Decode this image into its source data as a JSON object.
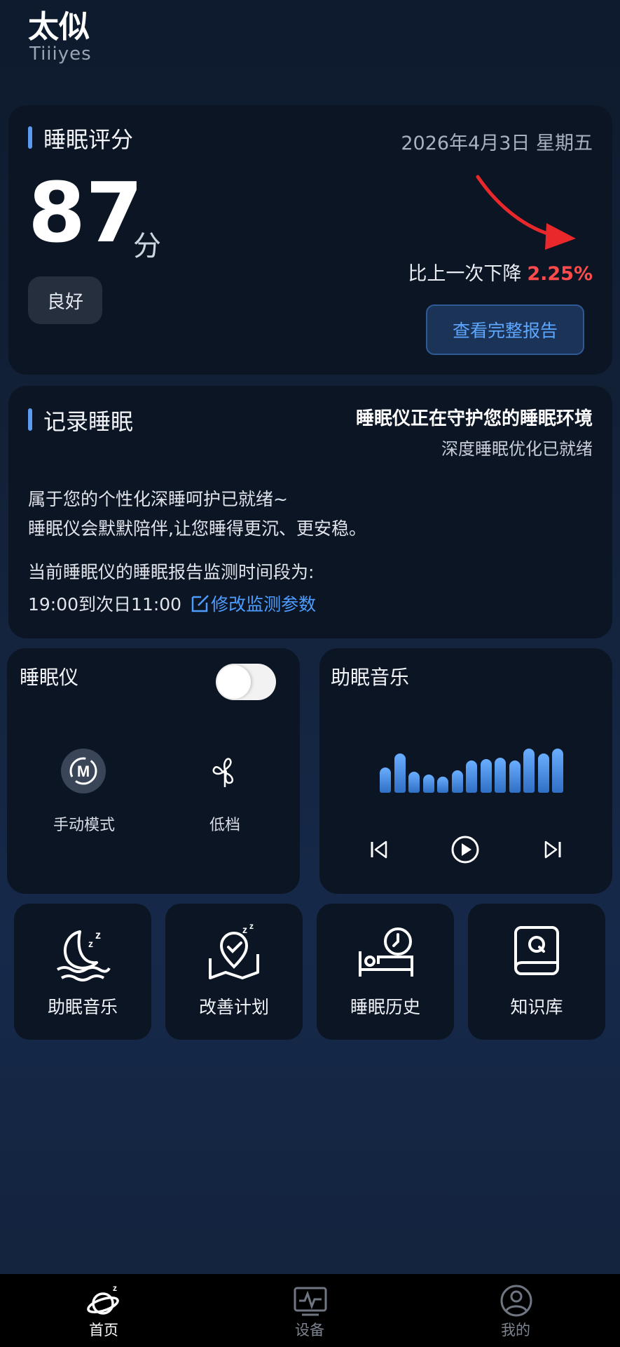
{
  "header": {
    "title": "太似",
    "subtitle": "Tiiiyes"
  },
  "score_card": {
    "title": "睡眠评分",
    "date": "2026年4月3日 星期五",
    "score": "87",
    "unit": "分",
    "level": "良好",
    "compare_text": "比上一次下降",
    "compare_value": "2.25%",
    "report_button": "查看完整报告",
    "trend": "down",
    "colors": {
      "trend": "#ff4b4b",
      "accent": "#5b9cf0"
    }
  },
  "record_card": {
    "title": "记录睡眠",
    "guard_title": "睡眠仪正在守护您的睡眠环境",
    "guard_subtitle": "深度睡眠优化已就绪",
    "line1": "属于您的个性化深睡呵护已就绪~",
    "line2": "睡眠仪会默默陪伴,让您睡得更沉、更安稳。",
    "line3": "当前睡眠仪的睡眠报告监测时间段为:",
    "time_range": "19:00到次日11:00",
    "edit_link": "修改监测参数"
  },
  "device_card": {
    "title": "睡眠仪",
    "power_on": true,
    "mode_label": "手动模式",
    "mode_icon": "m-mode-icon",
    "fan_label": "低档",
    "fan_icon": "fan-icon"
  },
  "music_card": {
    "title": "助眠音乐",
    "equalizer_levels": [
      0.55,
      0.85,
      0.45,
      0.4,
      0.35,
      0.48,
      0.7,
      0.72,
      0.75,
      0.7,
      0.95,
      0.85,
      0.95
    ]
  },
  "shortcuts": [
    {
      "label": "助眠音乐",
      "icon": "moon-sleep-icon"
    },
    {
      "label": "改善计划",
      "icon": "plan-map-icon"
    },
    {
      "label": "睡眠历史",
      "icon": "bed-clock-icon"
    },
    {
      "label": "知识库",
      "icon": "book-icon"
    }
  ],
  "bottom_nav": [
    {
      "label": "首页",
      "icon": "planet-icon",
      "active": true
    },
    {
      "label": "设备",
      "icon": "monitor-icon",
      "active": false
    },
    {
      "label": "我的",
      "icon": "profile-icon",
      "active": false
    }
  ]
}
